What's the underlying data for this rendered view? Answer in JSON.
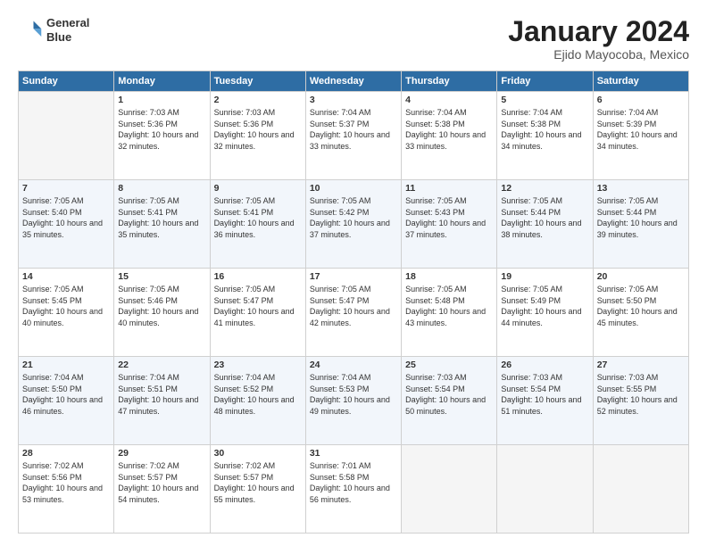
{
  "header": {
    "logo_line1": "General",
    "logo_line2": "Blue",
    "main_title": "January 2024",
    "subtitle": "Ejido Mayocoba, Mexico"
  },
  "days_of_week": [
    "Sunday",
    "Monday",
    "Tuesday",
    "Wednesday",
    "Thursday",
    "Friday",
    "Saturday"
  ],
  "weeks": [
    [
      {
        "day": "",
        "sunrise": "",
        "sunset": "",
        "daylight": ""
      },
      {
        "day": "1",
        "sunrise": "Sunrise: 7:03 AM",
        "sunset": "Sunset: 5:36 PM",
        "daylight": "Daylight: 10 hours and 32 minutes."
      },
      {
        "day": "2",
        "sunrise": "Sunrise: 7:03 AM",
        "sunset": "Sunset: 5:36 PM",
        "daylight": "Daylight: 10 hours and 32 minutes."
      },
      {
        "day": "3",
        "sunrise": "Sunrise: 7:04 AM",
        "sunset": "Sunset: 5:37 PM",
        "daylight": "Daylight: 10 hours and 33 minutes."
      },
      {
        "day": "4",
        "sunrise": "Sunrise: 7:04 AM",
        "sunset": "Sunset: 5:38 PM",
        "daylight": "Daylight: 10 hours and 33 minutes."
      },
      {
        "day": "5",
        "sunrise": "Sunrise: 7:04 AM",
        "sunset": "Sunset: 5:38 PM",
        "daylight": "Daylight: 10 hours and 34 minutes."
      },
      {
        "day": "6",
        "sunrise": "Sunrise: 7:04 AM",
        "sunset": "Sunset: 5:39 PM",
        "daylight": "Daylight: 10 hours and 34 minutes."
      }
    ],
    [
      {
        "day": "7",
        "sunrise": "Sunrise: 7:05 AM",
        "sunset": "Sunset: 5:40 PM",
        "daylight": "Daylight: 10 hours and 35 minutes."
      },
      {
        "day": "8",
        "sunrise": "Sunrise: 7:05 AM",
        "sunset": "Sunset: 5:41 PM",
        "daylight": "Daylight: 10 hours and 35 minutes."
      },
      {
        "day": "9",
        "sunrise": "Sunrise: 7:05 AM",
        "sunset": "Sunset: 5:41 PM",
        "daylight": "Daylight: 10 hours and 36 minutes."
      },
      {
        "day": "10",
        "sunrise": "Sunrise: 7:05 AM",
        "sunset": "Sunset: 5:42 PM",
        "daylight": "Daylight: 10 hours and 37 minutes."
      },
      {
        "day": "11",
        "sunrise": "Sunrise: 7:05 AM",
        "sunset": "Sunset: 5:43 PM",
        "daylight": "Daylight: 10 hours and 37 minutes."
      },
      {
        "day": "12",
        "sunrise": "Sunrise: 7:05 AM",
        "sunset": "Sunset: 5:44 PM",
        "daylight": "Daylight: 10 hours and 38 minutes."
      },
      {
        "day": "13",
        "sunrise": "Sunrise: 7:05 AM",
        "sunset": "Sunset: 5:44 PM",
        "daylight": "Daylight: 10 hours and 39 minutes."
      }
    ],
    [
      {
        "day": "14",
        "sunrise": "Sunrise: 7:05 AM",
        "sunset": "Sunset: 5:45 PM",
        "daylight": "Daylight: 10 hours and 40 minutes."
      },
      {
        "day": "15",
        "sunrise": "Sunrise: 7:05 AM",
        "sunset": "Sunset: 5:46 PM",
        "daylight": "Daylight: 10 hours and 40 minutes."
      },
      {
        "day": "16",
        "sunrise": "Sunrise: 7:05 AM",
        "sunset": "Sunset: 5:47 PM",
        "daylight": "Daylight: 10 hours and 41 minutes."
      },
      {
        "day": "17",
        "sunrise": "Sunrise: 7:05 AM",
        "sunset": "Sunset: 5:47 PM",
        "daylight": "Daylight: 10 hours and 42 minutes."
      },
      {
        "day": "18",
        "sunrise": "Sunrise: 7:05 AM",
        "sunset": "Sunset: 5:48 PM",
        "daylight": "Daylight: 10 hours and 43 minutes."
      },
      {
        "day": "19",
        "sunrise": "Sunrise: 7:05 AM",
        "sunset": "Sunset: 5:49 PM",
        "daylight": "Daylight: 10 hours and 44 minutes."
      },
      {
        "day": "20",
        "sunrise": "Sunrise: 7:05 AM",
        "sunset": "Sunset: 5:50 PM",
        "daylight": "Daylight: 10 hours and 45 minutes."
      }
    ],
    [
      {
        "day": "21",
        "sunrise": "Sunrise: 7:04 AM",
        "sunset": "Sunset: 5:50 PM",
        "daylight": "Daylight: 10 hours and 46 minutes."
      },
      {
        "day": "22",
        "sunrise": "Sunrise: 7:04 AM",
        "sunset": "Sunset: 5:51 PM",
        "daylight": "Daylight: 10 hours and 47 minutes."
      },
      {
        "day": "23",
        "sunrise": "Sunrise: 7:04 AM",
        "sunset": "Sunset: 5:52 PM",
        "daylight": "Daylight: 10 hours and 48 minutes."
      },
      {
        "day": "24",
        "sunrise": "Sunrise: 7:04 AM",
        "sunset": "Sunset: 5:53 PM",
        "daylight": "Daylight: 10 hours and 49 minutes."
      },
      {
        "day": "25",
        "sunrise": "Sunrise: 7:03 AM",
        "sunset": "Sunset: 5:54 PM",
        "daylight": "Daylight: 10 hours and 50 minutes."
      },
      {
        "day": "26",
        "sunrise": "Sunrise: 7:03 AM",
        "sunset": "Sunset: 5:54 PM",
        "daylight": "Daylight: 10 hours and 51 minutes."
      },
      {
        "day": "27",
        "sunrise": "Sunrise: 7:03 AM",
        "sunset": "Sunset: 5:55 PM",
        "daylight": "Daylight: 10 hours and 52 minutes."
      }
    ],
    [
      {
        "day": "28",
        "sunrise": "Sunrise: 7:02 AM",
        "sunset": "Sunset: 5:56 PM",
        "daylight": "Daylight: 10 hours and 53 minutes."
      },
      {
        "day": "29",
        "sunrise": "Sunrise: 7:02 AM",
        "sunset": "Sunset: 5:57 PM",
        "daylight": "Daylight: 10 hours and 54 minutes."
      },
      {
        "day": "30",
        "sunrise": "Sunrise: 7:02 AM",
        "sunset": "Sunset: 5:57 PM",
        "daylight": "Daylight: 10 hours and 55 minutes."
      },
      {
        "day": "31",
        "sunrise": "Sunrise: 7:01 AM",
        "sunset": "Sunset: 5:58 PM",
        "daylight": "Daylight: 10 hours and 56 minutes."
      },
      {
        "day": "",
        "sunrise": "",
        "sunset": "",
        "daylight": ""
      },
      {
        "day": "",
        "sunrise": "",
        "sunset": "",
        "daylight": ""
      },
      {
        "day": "",
        "sunrise": "",
        "sunset": "",
        "daylight": ""
      }
    ]
  ]
}
